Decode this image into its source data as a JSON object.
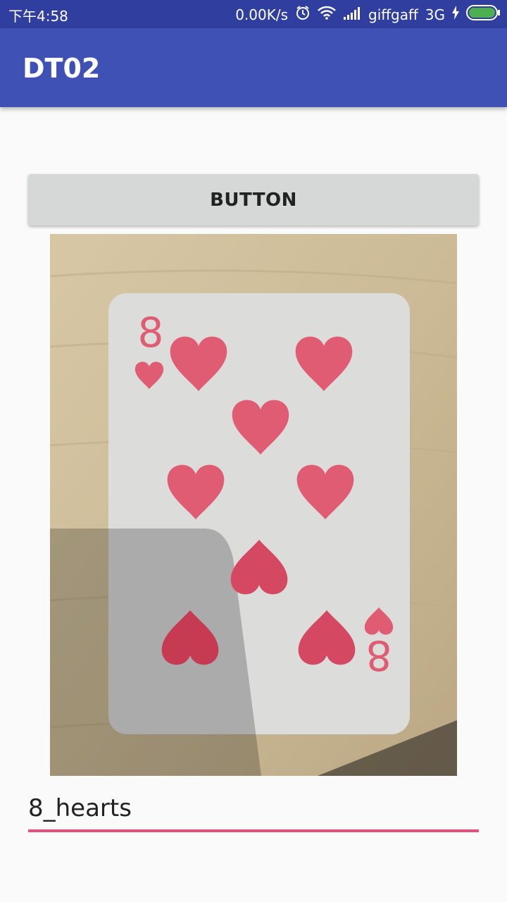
{
  "status_bar": {
    "time": "下午4:58",
    "network_speed": "0.00K/s",
    "carrier": "giffgaff",
    "network_type": "3G",
    "icons": [
      "alarm-icon",
      "wifi-icon",
      "signal-icon",
      "charging-icon",
      "battery-icon"
    ]
  },
  "app_bar": {
    "title": "DT02"
  },
  "main": {
    "button_label": "BUTTON",
    "image": {
      "depicts": "playing-card-8-of-hearts",
      "card_rank": "8",
      "card_suit": "hearts"
    },
    "text_field_value": "8_hearts"
  },
  "colors": {
    "status_bar": "#303f9f",
    "app_bar": "#3f51b5",
    "accent": "#e94d7a",
    "button": "#d6d7d7",
    "heart": "#e05c72"
  }
}
